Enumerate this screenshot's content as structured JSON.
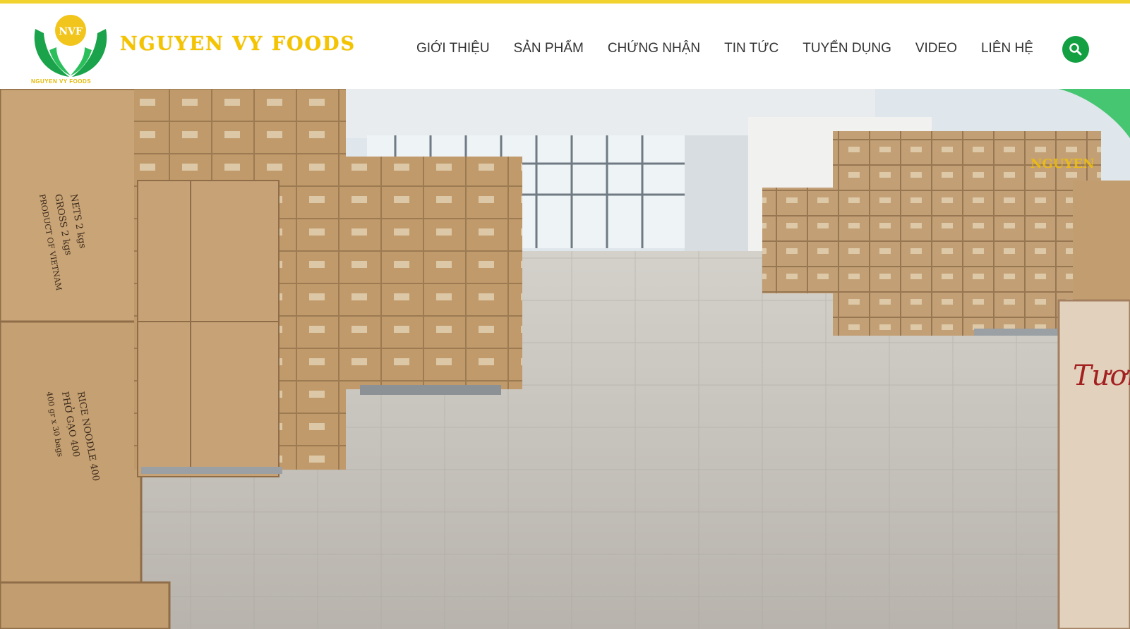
{
  "brand": {
    "name": "NGUYEN VY FOODS",
    "logo_initials": "NVF",
    "logo_caption": "NGUYEN VY FOODS"
  },
  "nav": {
    "items": [
      {
        "label": "GIỚI THIỆU"
      },
      {
        "label": "SẢN PHẨM"
      },
      {
        "label": "CHỨNG NHẬN"
      },
      {
        "label": "TIN TỨC"
      },
      {
        "label": "TUYỂN DỤNG"
      },
      {
        "label": "VIDEO"
      },
      {
        "label": "LIÊN HỆ"
      }
    ],
    "search_icon": "search-icon"
  },
  "colors": {
    "accent_yellow": "#f2d22e",
    "brand_gold": "#f4c400",
    "brand_green": "#12a043"
  },
  "hero": {
    "box_labels": {
      "nets": "NETS 2 kgs",
      "gross": "GROSS 2 kgs",
      "product": "PRODUCT OF VIETNAM",
      "rice_noodle": "RICE NOODLE 400",
      "pho": "PHỞ GẠO 400",
      "weight": "400 gr x 30 bags",
      "tuoi": "Tươi"
    },
    "watermark": "NGUYEN"
  }
}
